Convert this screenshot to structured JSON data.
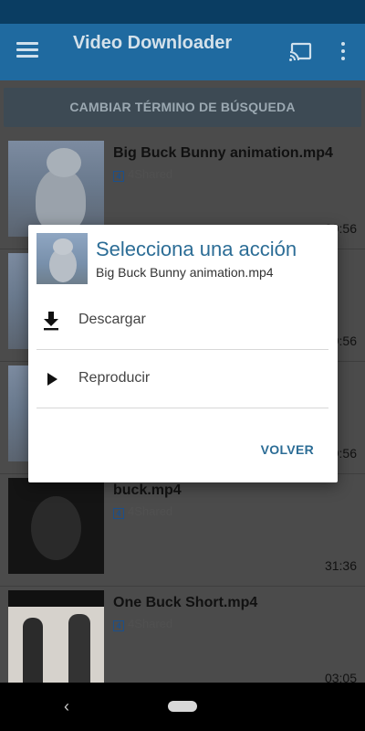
{
  "app": {
    "title": "Video Downloader"
  },
  "toolbar": {
    "menu_icon": "hamburger-menu-icon",
    "cast_icon": "cast-icon",
    "more_icon": "more-vertical-icon"
  },
  "search": {
    "button_label": "CAMBIAR TÉRMINO DE BÚSQUEDA"
  },
  "results": [
    {
      "name": "Big Buck Bunny animation.mp4",
      "source": "4Shared",
      "duration": "09:56"
    },
    {
      "name": "",
      "source": "",
      "duration": "09:56"
    },
    {
      "name": "",
      "source": "",
      "duration": "09:56"
    },
    {
      "name": "buck.mp4",
      "source": "4Shared",
      "duration": "31:36"
    },
    {
      "name": "One Buck Short.mp4",
      "source": "4Shared",
      "duration": "03:05"
    }
  ],
  "source_badge": "4",
  "dialog": {
    "title": "Selecciona una acción",
    "subtitle": "Big Buck Bunny animation.mp4",
    "actions": [
      {
        "label": "Descargar",
        "icon": "download-icon"
      },
      {
        "label": "Reproducir",
        "icon": "play-icon"
      }
    ],
    "dismiss_label": "VOLVER"
  },
  "nav": {
    "back_glyph": "‹"
  }
}
